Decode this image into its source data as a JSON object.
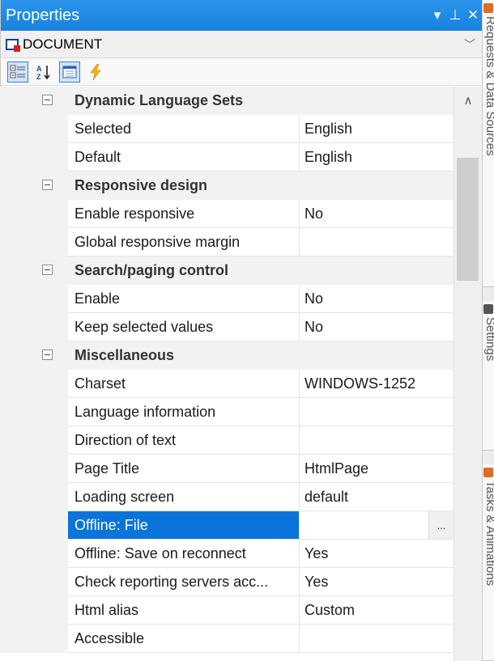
{
  "window": {
    "title": "Properties"
  },
  "title_controls": {
    "dropdown": "▾",
    "pin": "⊥",
    "close": "✕"
  },
  "object_selector": {
    "value": "DOCUMENT",
    "arrow": "﹀"
  },
  "toolbar": {
    "buttons": [
      {
        "name": "categorized",
        "icon": "categorized-icon"
      },
      {
        "name": "alphabetical",
        "icon": "sort-az-icon"
      },
      {
        "name": "property-pages",
        "icon": "property-pages-icon"
      },
      {
        "name": "events",
        "icon": "lightning-icon"
      }
    ]
  },
  "categories": [
    {
      "name": "Dynamic Language Sets",
      "properties": [
        {
          "name": "Selected",
          "value": "English"
        },
        {
          "name": "Default",
          "value": "English"
        }
      ]
    },
    {
      "name": "Responsive design",
      "properties": [
        {
          "name": "Enable responsive",
          "value": "No"
        },
        {
          "name": "Global responsive margin",
          "value": ""
        }
      ]
    },
    {
      "name": "Search/paging control",
      "properties": [
        {
          "name": "Enable",
          "value": "No"
        },
        {
          "name": "Keep selected values",
          "value": "No"
        }
      ]
    },
    {
      "name": "Miscellaneous",
      "properties": [
        {
          "name": "Charset",
          "value": "WINDOWS-1252"
        },
        {
          "name": "Language information",
          "value": ""
        },
        {
          "name": "Direction of text",
          "value": ""
        },
        {
          "name": "Page Title",
          "value": "HtmlPage"
        },
        {
          "name": "Loading screen",
          "value": "default"
        },
        {
          "name": "Offline: File",
          "value": "",
          "selected": true,
          "button": "..."
        },
        {
          "name": "Offline: Save on reconnect",
          "value": "Yes"
        },
        {
          "name": "Check reporting servers acc...",
          "value": "Yes"
        },
        {
          "name": "Html alias",
          "value": "Custom"
        },
        {
          "name": "Accessible",
          "value": ""
        }
      ]
    }
  ],
  "scrollbar": {
    "up_arrow": "∧"
  },
  "side_tabs": [
    {
      "label": "Requests & Data Sources"
    },
    {
      "label": "Settings"
    },
    {
      "label": "Tasks & Animations"
    }
  ],
  "colors": {
    "title_bar": "#1882e0",
    "selection": "#0a74da",
    "category_bg": "#f2f2f2"
  }
}
